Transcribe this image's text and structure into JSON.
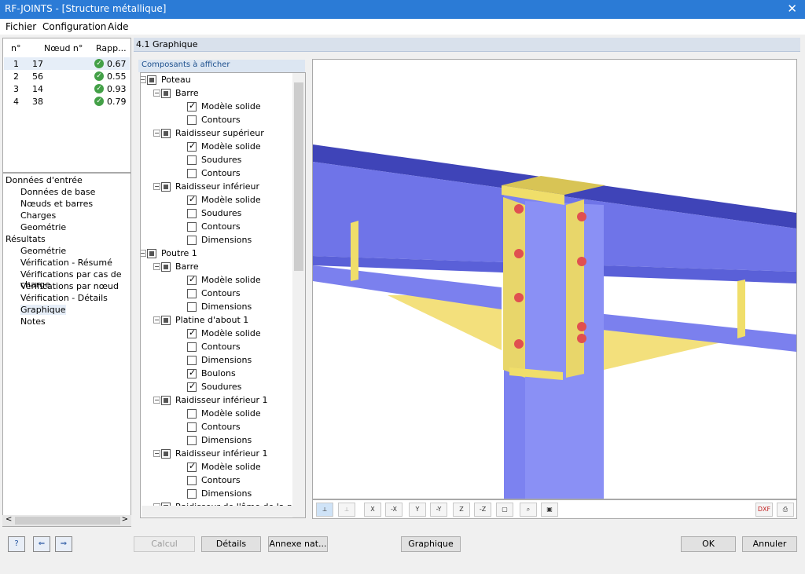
{
  "window": {
    "title": "RF-JOINTS - [Structure métallique]",
    "close": "✕"
  },
  "menu": [
    "Fichier",
    "Configuration",
    "Aide"
  ],
  "results_table": {
    "headers": [
      "n°",
      "Nœud n°",
      "Rapp..."
    ],
    "rows": [
      {
        "n": "1",
        "node": "17",
        "ratio": "0.67"
      },
      {
        "n": "2",
        "node": "56",
        "ratio": "0.55"
      },
      {
        "n": "3",
        "node": "14",
        "ratio": "0.93"
      },
      {
        "n": "4",
        "node": "38",
        "ratio": "0.79"
      }
    ]
  },
  "navigator": {
    "input_group": "Données d'entrée",
    "input_items": [
      "Données de base",
      "Nœuds et barres",
      "Charges",
      "Geométrie"
    ],
    "results_group": "Résultats",
    "result_items": [
      "Geométrie",
      "Vérification - Résumé",
      "Vérifications par cas de charge",
      "Vérifications par nœud",
      "Vérification - Détails",
      "Graphique",
      "Notes"
    ],
    "selected": "Graphique"
  },
  "panel_title": "4.1 Graphique",
  "components_label": "Composants à afficher",
  "tree": [
    {
      "label": "Poteau",
      "level": 0,
      "state": "full"
    },
    {
      "label": "Barre",
      "level": 1,
      "state": "full"
    },
    {
      "label": "Modèle solide",
      "level": 2,
      "state": "checked"
    },
    {
      "label": "Contours",
      "level": 2,
      "state": "unchecked"
    },
    {
      "label": "Raidisseur supérieur",
      "level": 1,
      "state": "full"
    },
    {
      "label": "Modèle solide",
      "level": 2,
      "state": "checked"
    },
    {
      "label": "Soudures",
      "level": 2,
      "state": "unchecked"
    },
    {
      "label": "Contours",
      "level": 2,
      "state": "unchecked"
    },
    {
      "label": "Raidisseur inférieur",
      "level": 1,
      "state": "full"
    },
    {
      "label": "Modèle solide",
      "level": 2,
      "state": "checked"
    },
    {
      "label": "Soudures",
      "level": 2,
      "state": "unchecked"
    },
    {
      "label": "Contours",
      "level": 2,
      "state": "unchecked"
    },
    {
      "label": "Dimensions",
      "level": 2,
      "state": "unchecked"
    },
    {
      "label": "Poutre 1",
      "level": 0,
      "state": "full"
    },
    {
      "label": "Barre",
      "level": 1,
      "state": "full"
    },
    {
      "label": "Modèle solide",
      "level": 2,
      "state": "checked"
    },
    {
      "label": "Contours",
      "level": 2,
      "state": "unchecked"
    },
    {
      "label": "Dimensions",
      "level": 2,
      "state": "unchecked"
    },
    {
      "label": "Platine d'about 1",
      "level": 1,
      "state": "full"
    },
    {
      "label": "Modèle solide",
      "level": 2,
      "state": "checked"
    },
    {
      "label": "Contours",
      "level": 2,
      "state": "unchecked"
    },
    {
      "label": "Dimensions",
      "level": 2,
      "state": "unchecked"
    },
    {
      "label": "Boulons",
      "level": 2,
      "state": "checked"
    },
    {
      "label": "Soudures",
      "level": 2,
      "state": "checked"
    },
    {
      "label": "Raidisseur inférieur 1",
      "level": 1,
      "state": "full"
    },
    {
      "label": "Modèle solide",
      "level": 2,
      "state": "unchecked"
    },
    {
      "label": "Contours",
      "level": 2,
      "state": "unchecked"
    },
    {
      "label": "Dimensions",
      "level": 2,
      "state": "unchecked"
    },
    {
      "label": "Raidisseur inférieur 1",
      "level": 1,
      "state": "full"
    },
    {
      "label": "Modèle solide",
      "level": 2,
      "state": "checked"
    },
    {
      "label": "Contours",
      "level": 2,
      "state": "unchecked"
    },
    {
      "label": "Dimensions",
      "level": 2,
      "state": "unchecked"
    },
    {
      "label": "Raidisseur de l'âme de la po",
      "level": 1,
      "state": "full"
    }
  ],
  "toolbar_icons": [
    "view-select-icon",
    "view-disabled-icon",
    "view-x-icon",
    "view-minus-x-icon",
    "view-y-icon",
    "view-minus-y-icon",
    "view-z-icon",
    "view-minus-z-icon",
    "view-iso-icon",
    "zoom-icon",
    "render-icon",
    "dxf-export-icon",
    "print-icon"
  ],
  "toolbar_labels": {
    "x": "X",
    "mx": "-X",
    "y": "Y",
    "my": "-Y",
    "z": "Z",
    "mz": "-Z",
    "dxf": "DXF"
  },
  "buttons": {
    "calc": "Calcul",
    "details": "Détails",
    "annex": "Annexe nat...",
    "graphic": "Graphique",
    "ok": "OK",
    "cancel": "Annuler"
  },
  "colors": {
    "titlebar": "#2b7bd6",
    "steel": "#6f74e8",
    "plate": "#f0de6a",
    "bolt": "#e05050",
    "ok": "#43a047"
  }
}
